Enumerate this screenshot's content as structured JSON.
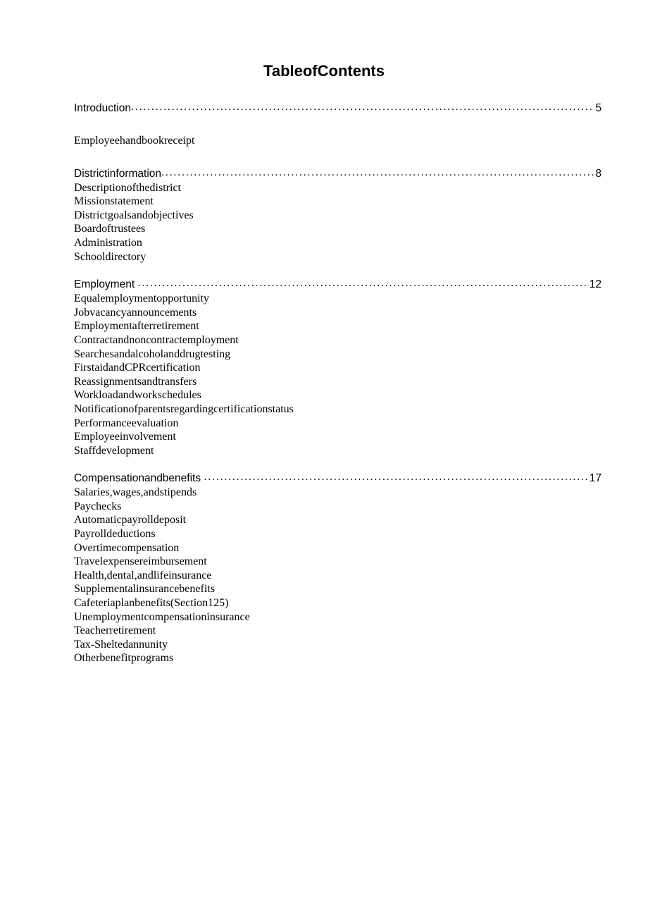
{
  "document": {
    "title": "TableofContents"
  },
  "toc": {
    "sections": [
      {
        "title": "Introduction",
        "page": "5",
        "spaced_leader": false,
        "items": [
          "Employeehandbookreceipt"
        ]
      },
      {
        "title": "Districtinformation",
        "page": "8",
        "spaced_leader": false,
        "items": [
          "Descriptionofthedistrict",
          "Missionstatement",
          "Districtgoalsandobjectives",
          "Boardoftrustees",
          "Administration",
          "Schooldirectory"
        ]
      },
      {
        "title": "Employment",
        "page": "12",
        "spaced_leader": true,
        "items": [
          "Equalemploymentopportunity",
          "Jobvacancyannouncements",
          "Employmentafterretirement",
          "Contractandnoncontractemployment",
          "Searchesandalcoholanddrugtesting",
          "FirstaidandCPRcertification",
          "Reassignmentsandtransfers",
          "Workloadandworkschedules",
          "Notificationofparentsregardingcertificationstatus",
          "Performanceevaluation",
          "Employeeinvolvement",
          "Staffdevelopment"
        ]
      },
      {
        "title": "Compensationandbenefits",
        "page": "17",
        "spaced_leader": true,
        "items": [
          "Salaries,wages,andstipends",
          "Paychecks",
          "Automaticpayrolldeposit",
          "Payrolldeductions",
          "Overtimecompensation",
          "Travelexpensereimbursement",
          "Health,dental,andlifeinsurance",
          "Supplementalinsurancebenefits",
          "Cafeteriaplanbenefits(Section125)",
          "Unemploymentcompensationinsurance",
          "Teacherretirement",
          "Tax-Sheltedannunity",
          "Otherbenefitprograms"
        ]
      }
    ]
  },
  "colors": {
    "text": "#000000",
    "background": "#ffffff"
  }
}
